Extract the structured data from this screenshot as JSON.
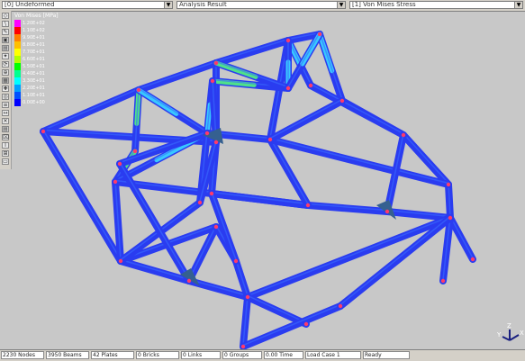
{
  "toolbar": {
    "combos": [
      {
        "label": "[0] Undeformed"
      },
      {
        "label": "Analysis Result"
      },
      {
        "label": "[1] Von Mises Stress"
      }
    ]
  },
  "tools": [
    "◇",
    "\\",
    "✎",
    "▣",
    "▤",
    "✦",
    "⟳",
    "⊕",
    "▦",
    "✚",
    "◎",
    "≡",
    "↔",
    "✕",
    "▤",
    "⌧",
    "I",
    "⊞",
    "▭"
  ],
  "legend": {
    "title": "Von Mises [MPa]",
    "entries": [
      {
        "label": "1.20E+02",
        "color": "#ff00ff"
      },
      {
        "label": "1.10E+02",
        "color": "#ff0000"
      },
      {
        "label": "9.90E+01",
        "color": "#ff7f00"
      },
      {
        "label": "8.80E+01",
        "color": "#ffbf00"
      },
      {
        "label": "7.70E+01",
        "color": "#ffff00"
      },
      {
        "label": "6.60E+01",
        "color": "#b0ff00"
      },
      {
        "label": "5.50E+01",
        "color": "#00ff00"
      },
      {
        "label": "4.40E+01",
        "color": "#00ff90"
      },
      {
        "label": "3.30E+01",
        "color": "#00ffff"
      },
      {
        "label": "2.20E+01",
        "color": "#00a0ff"
      },
      {
        "label": "1.10E+01",
        "color": "#0050ff"
      },
      {
        "label": "0.00E+00",
        "color": "#0000ff"
      }
    ]
  },
  "colors": {
    "tube": "#2a3cf0",
    "tube_light": "#3a6cff",
    "hot_green": "#4ee08a",
    "hot_cyan": "#38c8ff",
    "node": "#ff3a6a",
    "gusset": "#356090",
    "viewport_bg": "#c8c8c8"
  },
  "status": {
    "cells": [
      "2230 Nodes",
      "3950 Beams",
      "42 Plates",
      "0 Bricks",
      "0 Links",
      "0 Groups",
      "0.00 Time",
      "Load Case 1",
      "Ready"
    ]
  },
  "axes": {
    "x": "X",
    "y": "Y",
    "z": "Z"
  }
}
